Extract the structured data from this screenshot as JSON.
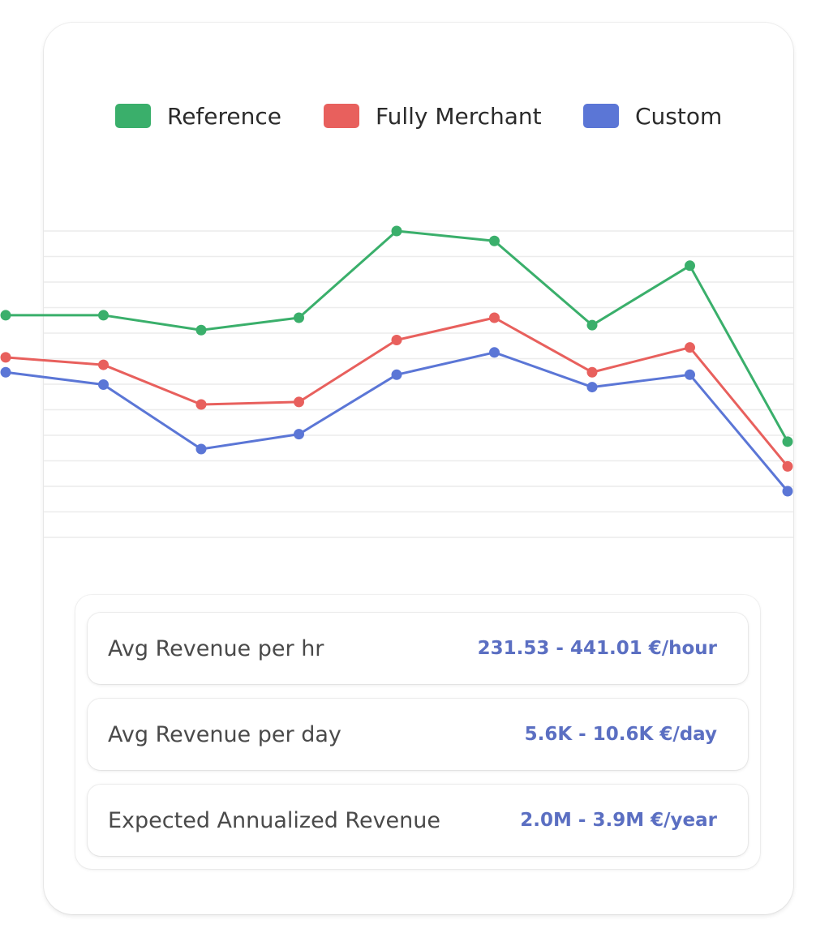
{
  "chart_data": {
    "type": "line",
    "x": [
      1,
      2,
      3,
      4,
      5,
      6,
      7,
      8,
      9
    ],
    "grid": true,
    "legend_position": "top",
    "ylim": [
      0,
      12
    ],
    "series": [
      {
        "name": "Reference",
        "color": "#3aaf6b",
        "values": [
          8.9,
          8.9,
          8.3,
          8.8,
          12.3,
          11.9,
          8.5,
          10.9,
          3.8
        ]
      },
      {
        "name": "Fully Merchant",
        "color": "#e8605d",
        "values": [
          7.2,
          6.9,
          5.3,
          5.4,
          7.9,
          8.8,
          6.6,
          7.6,
          2.8
        ]
      },
      {
        "name": "Custom",
        "color": "#5b76d6",
        "values": [
          6.6,
          6.1,
          3.5,
          4.1,
          6.5,
          7.4,
          6.0,
          6.5,
          1.8
        ]
      }
    ]
  },
  "metrics": [
    {
      "label": "Avg Revenue per hr",
      "value": "231.53 - 441.01 €/hour"
    },
    {
      "label": "Avg Revenue per day",
      "value": "5.6K - 10.6K €/day"
    },
    {
      "label": "Expected Annualized Revenue",
      "value": "2.0M - 3.9M €/year"
    }
  ]
}
